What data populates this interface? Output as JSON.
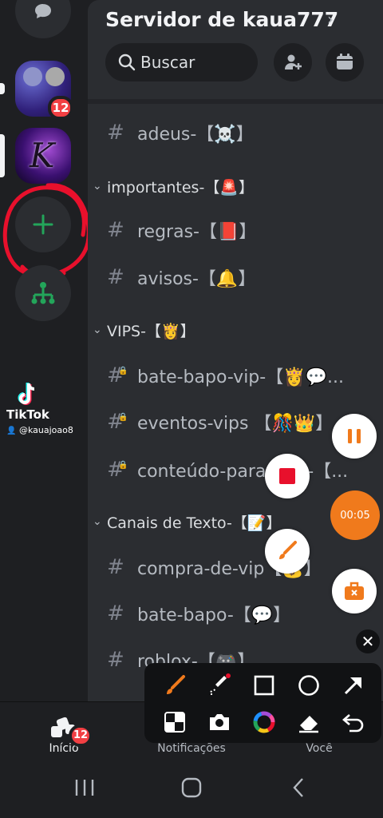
{
  "server": {
    "title": "Servidor de kaua777",
    "chevron": "›"
  },
  "search": {
    "label": "Buscar"
  },
  "rail": {
    "badge": "12",
    "server2_letter": "K"
  },
  "channels": [
    {
      "type": "channel",
      "name": "adeus-【☠️】"
    },
    {
      "type": "category",
      "name": "importantes-【🚨】"
    },
    {
      "type": "channel",
      "name": "regras-【📕】"
    },
    {
      "type": "channel",
      "name": "avisos-【🔔】"
    },
    {
      "type": "category",
      "name": "VIPS-【👸】"
    },
    {
      "type": "channel",
      "name": "bate-bapo-vip-【👸💬..."
    },
    {
      "type": "channel",
      "name": "eventos-vips 【🎊👑】"
    },
    {
      "type": "channel",
      "name": "conteúdo-para-vips-【..."
    },
    {
      "type": "category",
      "name": "Canais de Texto-【📝】"
    },
    {
      "type": "channel",
      "name": "compra-de-vip【💰】"
    },
    {
      "type": "channel",
      "name": "bate-bapo-【💬】"
    },
    {
      "type": "channel",
      "name": "roblox-【🎮】"
    }
  ],
  "bottom_nav": {
    "home": "Início",
    "home_badge": "12",
    "notifications": "Notificações",
    "you": "Você"
  },
  "watermark": {
    "brand": "TikTok",
    "user": "@kauajoao8"
  },
  "recorder": {
    "timer": "00:05"
  },
  "colors": {
    "accent_green": "#23a55a",
    "badge_red": "#f23f43",
    "timer_orange": "#f07a1c",
    "annotation_red": "#e8102c"
  },
  "icons": {
    "rail_top": "chat-bubble-icon",
    "add_server": "plus-icon",
    "discover": "hub-tree-icon",
    "search": "search-icon",
    "invite": "add-member-icon",
    "events": "calendar-icon"
  }
}
